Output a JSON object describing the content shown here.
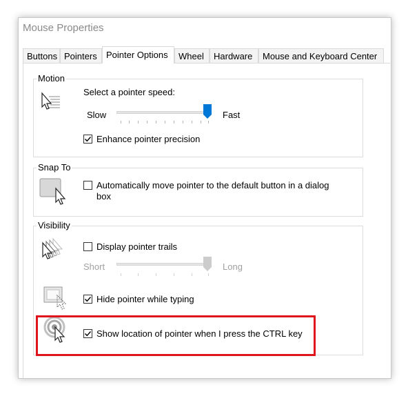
{
  "window": {
    "title": "Mouse Properties"
  },
  "tabs": [
    {
      "label": "Buttons"
    },
    {
      "label": "Pointers"
    },
    {
      "label": "Pointer Options",
      "active": true
    },
    {
      "label": "Wheel"
    },
    {
      "label": "Hardware"
    },
    {
      "label": "Mouse and Keyboard Center"
    }
  ],
  "motion": {
    "legend": "Motion",
    "speed_label": "Select a pointer speed:",
    "slow_label": "Slow",
    "fast_label": "Fast",
    "speed_level": 1.0,
    "precision_label": "Enhance pointer precision",
    "precision_checked": true
  },
  "snap_to": {
    "legend": "Snap To",
    "auto_label_line1": "Automatically move pointer to the default button in a dialog",
    "auto_label_line2": "box",
    "auto_checked": false
  },
  "visibility": {
    "legend": "Visibility",
    "trails_label": "Display pointer trails",
    "trails_checked": false,
    "short_label": "Short",
    "long_label": "Long",
    "trail_level": 1.0,
    "hide_label": "Hide pointer while typing",
    "hide_checked": true,
    "ctrl_label": "Show location of pointer when I press the CTRL key",
    "ctrl_checked": true
  },
  "colors": {
    "accent": "#0078d7",
    "highlight": "#e0141c"
  }
}
